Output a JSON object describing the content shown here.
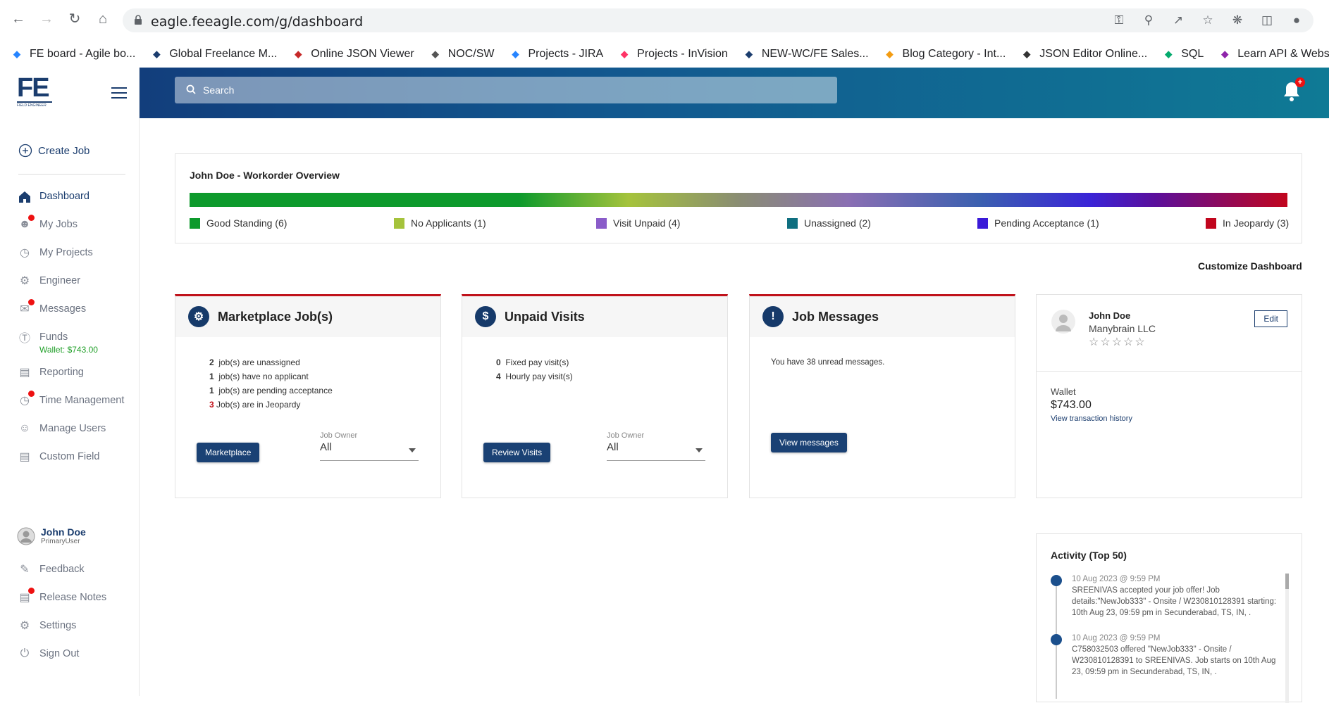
{
  "browser": {
    "url": "eagle.feeagle.com/g/dashboard",
    "bookmarks": [
      {
        "icon": "jira-icon",
        "label": "FE board - Agile bo..."
      },
      {
        "icon": "fe-icon",
        "label": "Global Freelance M..."
      },
      {
        "icon": "json-viewer-icon",
        "label": "Online JSON Viewer"
      },
      {
        "icon": "noc-icon",
        "label": "NOC/SW"
      },
      {
        "icon": "jira-icon",
        "label": "Projects - JIRA"
      },
      {
        "icon": "invision-icon",
        "label": "Projects - InVision"
      },
      {
        "icon": "fe-icon",
        "label": "NEW-WC/FE Sales..."
      },
      {
        "icon": "blog-icon",
        "label": "Blog Category - Int..."
      },
      {
        "icon": "json-editor-icon",
        "label": "JSON Editor Online..."
      },
      {
        "icon": "w3-icon",
        "label": "SQL"
      },
      {
        "icon": "api-icon",
        "label": "Learn API & Webse..."
      }
    ]
  },
  "sidebar": {
    "logo_text": "FE",
    "logo_sub": "FIELD ENGINEER",
    "create_job": "Create Job",
    "items": [
      {
        "label": "Dashboard"
      },
      {
        "label": "My Jobs"
      },
      {
        "label": "My Projects"
      },
      {
        "label": "Engineer"
      },
      {
        "label": "Messages"
      },
      {
        "label": "Funds"
      },
      {
        "label": "Reporting"
      },
      {
        "label": "Time Management"
      },
      {
        "label": "Manage Users"
      },
      {
        "label": "Custom Field"
      }
    ],
    "wallet": "Wallet: $743.00",
    "user": {
      "name": "John Doe",
      "role": "PrimaryUser"
    },
    "bottom_items": [
      {
        "label": "Feedback"
      },
      {
        "label": "Release Notes"
      },
      {
        "label": "Settings"
      },
      {
        "label": "Sign Out"
      }
    ]
  },
  "header": {
    "search_placeholder": "Search",
    "notification_badge": "+"
  },
  "overview": {
    "title": "John Doe - Workorder Overview",
    "legend": [
      {
        "label": "Good Standing (6)",
        "color": "#0d9a2c"
      },
      {
        "label": "No Applicants (1)",
        "color": "#a5c33c"
      },
      {
        "label": "Visit Unpaid (4)",
        "color": "#8a5cc9"
      },
      {
        "label": "Unassigned (2)",
        "color": "#0f6f80"
      },
      {
        "label": "Pending Acceptance (1)",
        "color": "#3a1ad8"
      },
      {
        "label": "In Jeopardy (3)",
        "color": "#c1051d"
      }
    ]
  },
  "customize": "Customize Dashboard",
  "cards": {
    "marketplace": {
      "title": "Marketplace Job(s)",
      "lines": [
        {
          "n": "2",
          "text": "job(s) are unassigned"
        },
        {
          "n": "1",
          "text": "job(s) have no applicant"
        },
        {
          "n": "1",
          "text": "job(s) are pending acceptance"
        },
        {
          "n": "3",
          "text": "Job(s) are in Jeopardy"
        }
      ],
      "button": "Marketplace",
      "owner_label": "Job Owner",
      "owner_value": "All"
    },
    "unpaid": {
      "title": "Unpaid Visits",
      "lines": [
        {
          "n": "0",
          "text": "Fixed pay visit(s)"
        },
        {
          "n": "4",
          "text": "Hourly pay visit(s)"
        }
      ],
      "button": "Review Visits",
      "owner_label": "Job Owner",
      "owner_value": "All"
    },
    "messages": {
      "title": "Job Messages",
      "text": "You have 38 unread messages.",
      "button": "View messages"
    }
  },
  "profile": {
    "name": "John Doe",
    "company": "Manybrain LLC",
    "rating": "☆☆☆☆☆",
    "edit": "Edit",
    "wallet_label": "Wallet",
    "wallet_amount": "$743.00",
    "history_link": "View transaction history"
  },
  "activity": {
    "title": "Activity (Top 50)",
    "items": [
      {
        "time": "10 Aug 2023 @ 9:59 PM",
        "text": "SREENIVAS accepted your job offer! Job details:\"NewJob333\" - Onsite / W230810128391 starting: 10th Aug 23, 09:59 pm in Secunderabad, TS, IN, ."
      },
      {
        "time": "10 Aug 2023 @ 9:59 PM",
        "text": "C758032503 offered \"NewJob333\" - Onsite / W230810128391 to SREENIVAS. Job starts on 10th Aug 23, 09:59 pm in Secunderabad, TS, IN, ."
      }
    ]
  }
}
